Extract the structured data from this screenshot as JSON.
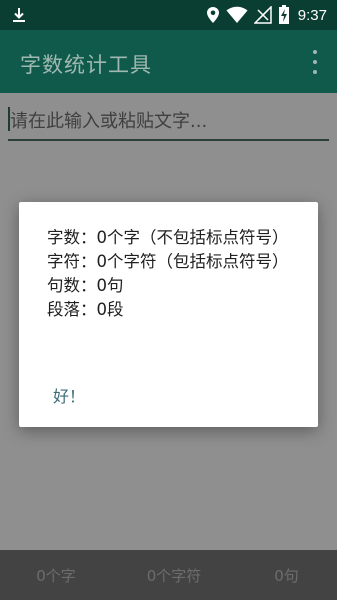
{
  "status_bar": {
    "time": "9:37",
    "icons": [
      "download-icon",
      "location-icon",
      "wifi-icon",
      "signal-icon",
      "battery-charging-icon"
    ]
  },
  "app_bar": {
    "title": "字数统计工具",
    "menu_icon": "more-vert-icon"
  },
  "editor": {
    "placeholder": "请在此输入或粘贴文字...",
    "value": ""
  },
  "dialog": {
    "lines": [
      "字数：0个字（不包括标点符号）",
      "字符：0个字符（包括标点符号）",
      "句数：0句",
      "段落：0段"
    ],
    "ok_label": "好！"
  },
  "bottom_bar": {
    "chars": "0个字",
    "characters": "0个字符",
    "sentences": "0句"
  },
  "colors": {
    "status_bar": "#0b3e33",
    "app_bar": "#0f5a4a",
    "accent": "#3a6d78",
    "bottom_bar": "#434343"
  }
}
